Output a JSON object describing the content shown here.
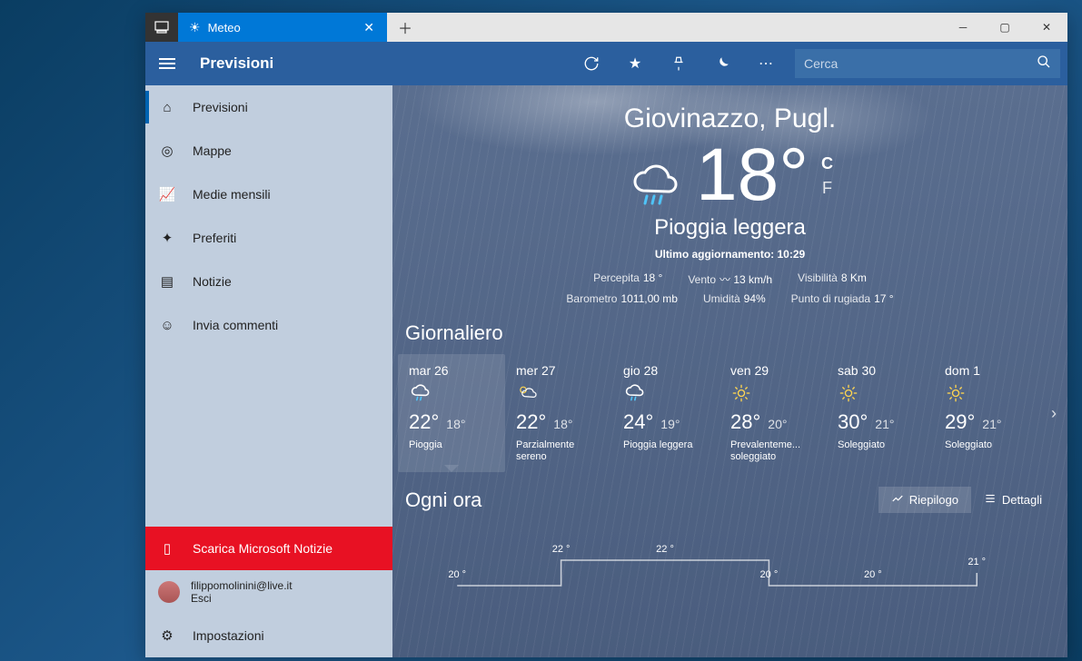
{
  "tab": {
    "title": "Meteo"
  },
  "cmdbar": {
    "title": "Previsioni"
  },
  "search": {
    "placeholder": "Cerca"
  },
  "sidebar": {
    "items": [
      {
        "label": "Previsioni",
        "icon": "home"
      },
      {
        "label": "Mappe",
        "icon": "radar"
      },
      {
        "label": "Medie mensili",
        "icon": "chart"
      },
      {
        "label": "Preferiti",
        "icon": "sparkle"
      },
      {
        "label": "Notizie",
        "icon": "news"
      },
      {
        "label": "Invia commenti",
        "icon": "smile"
      }
    ],
    "promo": "Scarica Microsoft Notizie",
    "account": {
      "email": "filippomolinini@live.it",
      "signout": "Esci"
    },
    "settings": "Impostazioni"
  },
  "hero": {
    "location": "Giovinazzo, Pugl.",
    "temp": "18°",
    "unit_c": "C",
    "unit_f": "F",
    "condition": "Pioggia leggera",
    "updated": "Ultimo aggiornamento: 10:29",
    "details": [
      {
        "label": "Percepita",
        "value": "18 °"
      },
      {
        "label": "Vento",
        "value": "13 km/h"
      },
      {
        "label": "Visibilità",
        "value": "8 Km"
      }
    ],
    "details2": [
      {
        "label": "Barometro",
        "value": "1011,00 mb"
      },
      {
        "label": "Umidità",
        "value": "94%"
      },
      {
        "label": "Punto di rugiada",
        "value": "17 °"
      }
    ]
  },
  "daily": {
    "title": "Giornaliero",
    "items": [
      {
        "date": "mar 26",
        "hi": "22°",
        "lo": "18°",
        "cond": "Pioggia",
        "icon": "rain"
      },
      {
        "date": "mer 27",
        "hi": "22°",
        "lo": "18°",
        "cond": "Parzialmente sereno",
        "icon": "partly"
      },
      {
        "date": "gio 28",
        "hi": "24°",
        "lo": "19°",
        "cond": "Pioggia leggera",
        "icon": "rain"
      },
      {
        "date": "ven 29",
        "hi": "28°",
        "lo": "20°",
        "cond": "Prevalenteme... soleggiato",
        "icon": "sun"
      },
      {
        "date": "sab 30",
        "hi": "30°",
        "lo": "21°",
        "cond": "Soleggiato",
        "icon": "sun"
      },
      {
        "date": "dom 1",
        "hi": "29°",
        "lo": "21°",
        "cond": "Soleggiato",
        "icon": "sun"
      }
    ]
  },
  "hourly": {
    "title": "Ogni ora",
    "summary": "Riepilogo",
    "details": "Dettagli",
    "points": [
      {
        "temp": "20 °",
        "x": 8,
        "y": 48
      },
      {
        "temp": "22 °",
        "x": 24,
        "y": 20
      },
      {
        "temp": "22 °",
        "x": 40,
        "y": 20
      },
      {
        "temp": "20 °",
        "x": 56,
        "y": 48
      },
      {
        "temp": "20 °",
        "x": 72,
        "y": 48
      },
      {
        "temp": "21 °",
        "x": 88,
        "y": 34
      }
    ]
  }
}
